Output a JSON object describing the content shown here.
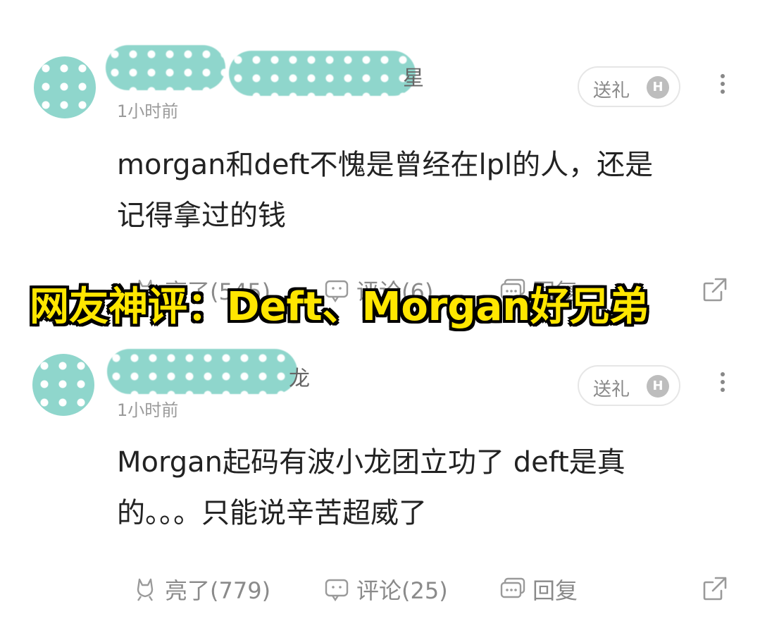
{
  "comments": [
    {
      "name_visible_fragment": "星",
      "time": "1小时前",
      "gift_label": "送礼",
      "gift_badge": "H",
      "text_line1": "morgan和deft不愧是曾经在lpl的人，还是",
      "text_line2": "记得拿过的钱",
      "like_label": "亮了(545)",
      "comment_label": "评论(6)",
      "reply_label": "回复"
    },
    {
      "name_visible_fragment": "龙",
      "time": "1小时前",
      "gift_label": "送礼",
      "gift_badge": "H",
      "text_line1": "Morgan起码有波小龙团立功了 deft是真",
      "text_line2": "的。。。只能说辛苦超威了",
      "like_label": "亮了(779)",
      "comment_label": "评论(25)",
      "reply_label": "回复"
    }
  ],
  "overlay_caption": "网友神评：Deft、Morgan好兄弟",
  "colors": {
    "overlay_text": "#ffe600",
    "overlay_stroke": "#000000",
    "blur_mosaic": "#8fd6cc",
    "muted_text": "#8a8a8a"
  },
  "icons": [
    "more-vertical-icon",
    "like-icon",
    "comment-icon",
    "reply-icon",
    "share-icon",
    "gift-h-badge-icon"
  ]
}
